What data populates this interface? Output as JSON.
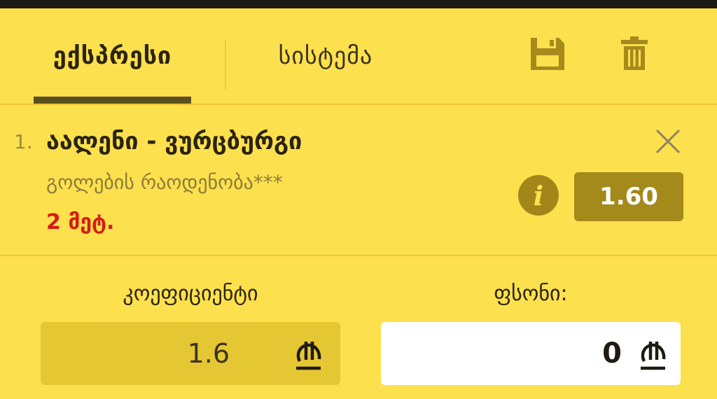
{
  "tabs": {
    "express_label": "ექსპრესი",
    "system_label": "სისტემა"
  },
  "toolbar": {
    "save_icon": "floppy-disk-icon",
    "delete_icon": "trash-icon"
  },
  "bet": {
    "number": "1.",
    "event": "აალენი - ვურცბურგი",
    "market": "გოლების რაოდენობა***",
    "time": "2 მეტ.",
    "odds": "1.60",
    "info_icon": "info-icon",
    "close_icon": "close-icon"
  },
  "coefficient": {
    "label": "კოეფიციენტი",
    "value": "1.6",
    "currency_icon": "lari-icon"
  },
  "stake": {
    "label": "ფსონი:",
    "value": "0",
    "currency_icon": "lari-icon"
  },
  "colors": {
    "background": "#fde04d",
    "accent_dark": "#5b4f1c",
    "odds_badge": "#a4891b",
    "time_red": "#d31d14"
  }
}
